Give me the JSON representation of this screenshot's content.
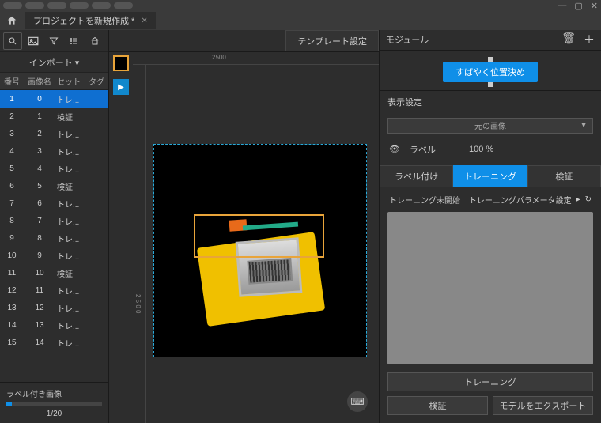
{
  "tab_title": "プロジェクトを新規作成 *",
  "sidebar": {
    "import_label": "インポート ▾",
    "headers": {
      "idx": "番号",
      "img": "画像名",
      "set": "セット",
      "tag": "タグ"
    },
    "rows": [
      {
        "idx": "1",
        "img": "0",
        "set": "トレ...",
        "selected": true
      },
      {
        "idx": "2",
        "img": "1",
        "set": "検証"
      },
      {
        "idx": "3",
        "img": "2",
        "set": "トレ..."
      },
      {
        "idx": "4",
        "img": "3",
        "set": "トレ..."
      },
      {
        "idx": "5",
        "img": "4",
        "set": "トレ..."
      },
      {
        "idx": "6",
        "img": "5",
        "set": "検証"
      },
      {
        "idx": "7",
        "img": "6",
        "set": "トレ..."
      },
      {
        "idx": "8",
        "img": "7",
        "set": "トレ..."
      },
      {
        "idx": "9",
        "img": "8",
        "set": "トレ..."
      },
      {
        "idx": "10",
        "img": "9",
        "set": "トレ..."
      },
      {
        "idx": "11",
        "img": "10",
        "set": "検証"
      },
      {
        "idx": "12",
        "img": "11",
        "set": "トレ..."
      },
      {
        "idx": "13",
        "img": "12",
        "set": "トレ..."
      },
      {
        "idx": "14",
        "img": "13",
        "set": "トレ..."
      },
      {
        "idx": "15",
        "img": "14",
        "set": "トレ..."
      }
    ],
    "footer_label": "ラベル付き画像",
    "progress": "1/20"
  },
  "center": {
    "template_button": "テンプレート設定",
    "ruler_tick": "2500"
  },
  "right": {
    "header": "モジュール",
    "quick_pos": "すばやく位置決め",
    "display_settings": "表示設定",
    "dropdown_value": "元の画像",
    "label_text": "ラベル",
    "label_pct": "100 %",
    "tabs": {
      "label": "ラベル付け",
      "train": "トレーニング",
      "verify": "検証"
    },
    "training_status": "トレーニング未開始",
    "training_params": "トレーニングパラメータ設定",
    "btn_train": "トレーニング",
    "btn_verify": "検証",
    "btn_export": "モデルをエクスポート"
  }
}
